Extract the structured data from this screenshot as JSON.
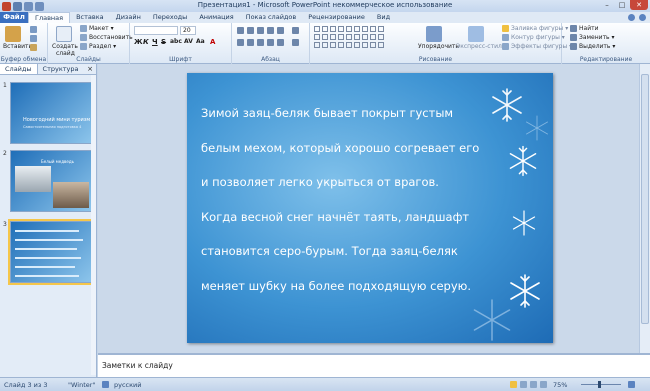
{
  "window": {
    "title": "Презентация1  -  Microsoft PowerPoint некоммерческое использование",
    "minimize": "–",
    "maximize": "□",
    "close": "✕"
  },
  "ribbon_tabs": [
    "Файл",
    "Главная",
    "Вставка",
    "Дизайн",
    "Переходы",
    "Анимация",
    "Показ слайдов",
    "Рецензирование",
    "Вид"
  ],
  "ribbon": {
    "clipboard": {
      "paste": "Вставить",
      "label": "Буфер обмена"
    },
    "slides": {
      "create": "Создать",
      "create2": "слайд",
      "layout": "Макет ▾",
      "reset": "Восстановить",
      "section": "Раздел ▾",
      "label": "Слайды"
    },
    "font": {
      "label": "Шрифт",
      "size": "20",
      "bold": "Ж",
      "italic": "К",
      "underline": "Ч",
      "strike": "S",
      "shadow": "abc",
      "spacing": "AV",
      "case": "Aa",
      "color": "A"
    },
    "paragraph": {
      "label": "Абзац"
    },
    "drawing": {
      "arrange": "Упорядочить",
      "quick_styles": "Экспресс-стили",
      "fill": "Заливка фигуры ▾",
      "outline": "Контур фигуры ▾",
      "effects": "Эффекты фигуры ▾",
      "label": "Рисование"
    },
    "editing": {
      "find": "Найти",
      "replace": "Заменить ▾",
      "select": "Выделить ▾",
      "label": "Редактирование"
    }
  },
  "left_panel": {
    "tabs": [
      "Слайды",
      "Структура"
    ],
    "close": "×",
    "thumbnails": [
      {
        "number": "1",
        "title": "Новогодний мини туризм",
        "subtitle": "Самостоятельная подготовка 4"
      },
      {
        "number": "2",
        "title": "Белый медведь"
      },
      {
        "number": "3",
        "selected": true
      }
    ]
  },
  "slide": {
    "lines": [
      "Зимой заяц-беляк бывает покрыт густым",
      "белым мехом, который хорошо согревает его",
      "и позволяет легко укрыться от врагов.",
      "Когда  весной снег начнёт таять, ландшафт",
      "становится серо-бурым. Тогда заяц-беляк",
      "меняет шубку на более подходящую серую."
    ]
  },
  "notes": {
    "placeholder": "Заметки к слайду"
  },
  "status": {
    "slide": "Слайд 3 из 3",
    "theme": "\"Winter\"",
    "language": "русский",
    "zoom": "75%"
  },
  "colors": {
    "file_tab": "#3a6fc0",
    "slide_bg": "#3d93d3",
    "ribbon_bg": "#fdfeff"
  }
}
